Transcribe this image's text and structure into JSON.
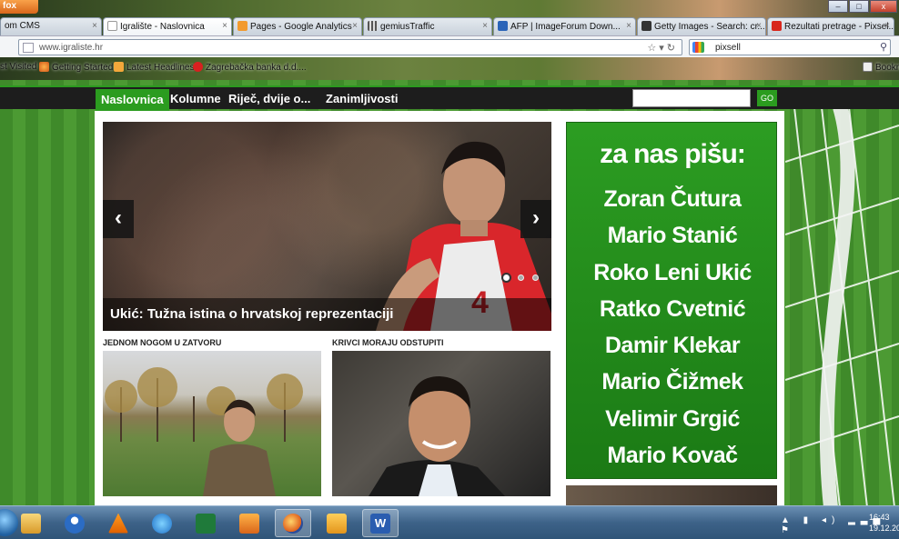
{
  "browser": {
    "menu_button": "fox",
    "window_controls": {
      "minimize": "–",
      "maximize": "□",
      "close": "x"
    },
    "tabs": [
      {
        "label": "om CMS",
        "icon": "page-icon",
        "active": false
      },
      {
        "label": "Igralište - Naslovnica",
        "icon": "page-icon",
        "active": true
      },
      {
        "label": "Pages - Google Analytics",
        "icon": "analytics-icon",
        "active": false
      },
      {
        "label": "gemiusTraffic",
        "icon": "grid-icon",
        "active": false
      },
      {
        "label": "AFP | ImageForum Down...",
        "icon": "afp-icon",
        "active": false
      },
      {
        "label": "Getty Images - Search: cr...",
        "icon": "getty-icon",
        "active": false
      },
      {
        "label": "Rezultati pretrage - Pixsel...",
        "icon": "pxl-icon",
        "active": false
      }
    ],
    "url": "www.igraliste.hr",
    "search_value": "pixsell",
    "bookmarks": [
      {
        "label": "st Visited",
        "icon": "star-icon"
      },
      {
        "label": "Getting Started",
        "icon": "firefox-icon"
      },
      {
        "label": "Latest Headlines",
        "icon": "rss-icon"
      },
      {
        "label": "Zagrebačka banka d.d....",
        "icon": "bank-icon"
      },
      {
        "label": "Bookm",
        "icon": "bookmarks-icon"
      }
    ]
  },
  "site": {
    "nav": [
      {
        "label": "Naslovnica",
        "active": true
      },
      {
        "label": "Kolumne",
        "active": false
      },
      {
        "label": "Riječ, dvije o...",
        "active": false
      },
      {
        "label": "Zanimljivosti",
        "active": false
      }
    ],
    "search_button": "GO",
    "slider": {
      "caption": "Ukić: Tužna istina o hrvatskoj reprezentaciji",
      "jersey_number": "4",
      "dots": 3,
      "active_dot": 0
    },
    "stories": [
      {
        "heading": "JEDNOM NOGOM U ZATVORU"
      },
      {
        "heading": "KRIVCI MORAJU ODSTUPITI"
      }
    ],
    "writers_title": "za nas pišu:",
    "writers": [
      "Zoran Čutura",
      "Mario Stanić",
      "Roko Leni Ukić",
      "Ratko Cvetnić",
      "Damir Klekar",
      "Mario Čižmek",
      "Velimir Grgić",
      "Mario Kovač"
    ],
    "colors": {
      "accent": "#2b9c1f",
      "nav_bg": "#1d1d1d"
    }
  },
  "taskbar": {
    "apps": [
      "explorer-icon",
      "user-icon",
      "vlc-icon",
      "ie-icon",
      "excel-icon",
      "media-icon",
      "firefox-icon",
      "outlook-icon",
      "word-icon"
    ],
    "active_app": "firefox-icon",
    "tray_icons": "▲ ▮ ◂) ▂▃▅ ⚑",
    "time": "16:43",
    "date": "19.12.20"
  }
}
